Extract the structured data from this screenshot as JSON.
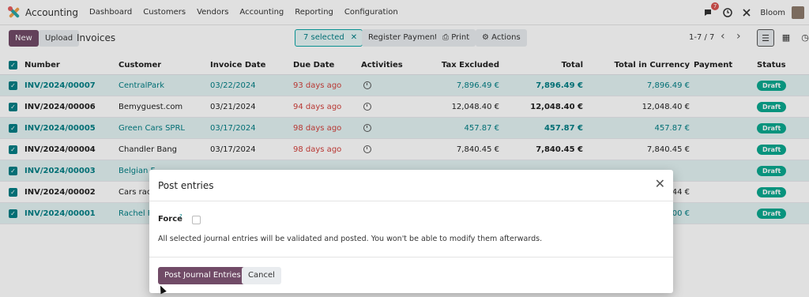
{
  "nav": {
    "app_name": "Accounting",
    "menu": [
      "Dashboard",
      "Customers",
      "Vendors",
      "Accounting",
      "Reporting",
      "Configuration"
    ],
    "chat_badge": "7",
    "company": "Bloom"
  },
  "control": {
    "new_label": "New",
    "upload_label": "Upload",
    "breadcrumb": "Invoices",
    "selected_label": "7 selected",
    "register_payment_label": "Register Payment",
    "print_label": "Print",
    "actions_label": "Actions",
    "pager": "1-7 / 7"
  },
  "table": {
    "headers": {
      "number": "Number",
      "customer": "Customer",
      "invoice_date": "Invoice Date",
      "due_date": "Due Date",
      "activities": "Activities",
      "tax_excluded": "Tax Excluded",
      "total": "Total",
      "total_currency": "Total in Currency",
      "payment": "Payment",
      "status": "Status"
    },
    "rows": [
      {
        "number": "INV/2024/00007",
        "customer": "CentralPark",
        "invoice_date": "03/22/2024",
        "due_date": "93 days ago",
        "tax_excluded": "7,896.49 €",
        "total": "7,896.49 €",
        "total_currency": "7,896.49 €",
        "status": "Draft"
      },
      {
        "number": "INV/2024/00006",
        "customer": "Bemyguest.com",
        "invoice_date": "03/21/2024",
        "due_date": "94 days ago",
        "tax_excluded": "12,048.40 €",
        "total": "12,048.40 €",
        "total_currency": "12,048.40 €",
        "status": "Draft"
      },
      {
        "number": "INV/2024/00005",
        "customer": "Green Cars SPRL",
        "invoice_date": "03/17/2024",
        "due_date": "98 days ago",
        "tax_excluded": "457.87 €",
        "total": "457.87 €",
        "total_currency": "457.87 €",
        "status": "Draft"
      },
      {
        "number": "INV/2024/00004",
        "customer": "Chandler Bang",
        "invoice_date": "03/17/2024",
        "due_date": "98 days ago",
        "tax_excluded": "7,840.45 €",
        "total": "7,840.45 €",
        "total_currency": "7,840.45 €",
        "status": "Draft"
      },
      {
        "number": "INV/2024/00003",
        "customer": "Belgian F",
        "invoice_date": "",
        "due_date": "",
        "tax_excluded": "",
        "total": "",
        "total_currency": "",
        "status": "Draft"
      },
      {
        "number": "INV/2024/00002",
        "customer": "Cars race",
        "invoice_date": "",
        "due_date": "",
        "tax_excluded": "",
        "total": "",
        "total_currency": "44 €",
        "status": "Draft"
      },
      {
        "number": "INV/2024/00001",
        "customer": "Rachel P",
        "invoice_date": "",
        "due_date": "",
        "tax_excluded": "",
        "total": "",
        "total_currency": "00 €",
        "status": "Draft"
      }
    ]
  },
  "modal": {
    "title": "Post entries",
    "force_label": "Force",
    "force_help": "?",
    "message": "All selected journal entries will be validated and posted. You won't be able to modify them afterwards.",
    "post_label": "Post Journal Entries",
    "cancel_label": "Cancel"
  },
  "colors": {
    "primary": "#714b67",
    "accent": "#017e84",
    "danger": "#d23f3a",
    "status_draft": "#0aa88f"
  }
}
